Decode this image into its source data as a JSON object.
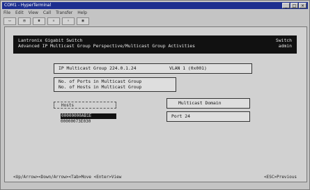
{
  "window": {
    "title": "COM1 - HyperTerminal",
    "menu": [
      "File",
      "Edit",
      "View",
      "Call",
      "Transfer",
      "Help"
    ],
    "toolbar": [
      "new",
      "open",
      "disconnect",
      "call",
      "send",
      "properties"
    ]
  },
  "header": {
    "line1": "Lantronix Gigabit Switch",
    "line2": "Advanced IP Multicast Group Perspective/Multicast Group Activities",
    "right1": "Switch",
    "right2": "admin"
  },
  "group": {
    "label": "IP Multicast Group 224.0.1.24",
    "vlan": "VLAN 1 (0x001)"
  },
  "counts": {
    "ports_label": "No. of Ports in Multicast Group",
    "hosts_label": "No. of Hosts in Multicast Group"
  },
  "hosts": {
    "title": "Hosts",
    "items": [
      "00000000AB1E",
      "00000073E030"
    ]
  },
  "domain": {
    "title": "Multicast Domain",
    "port": "Port 24"
  },
  "footer": {
    "left": "<Up/Arrow><Down/Arrow><Tab>Move <Enter>View",
    "right": "<ESC>Previous"
  }
}
